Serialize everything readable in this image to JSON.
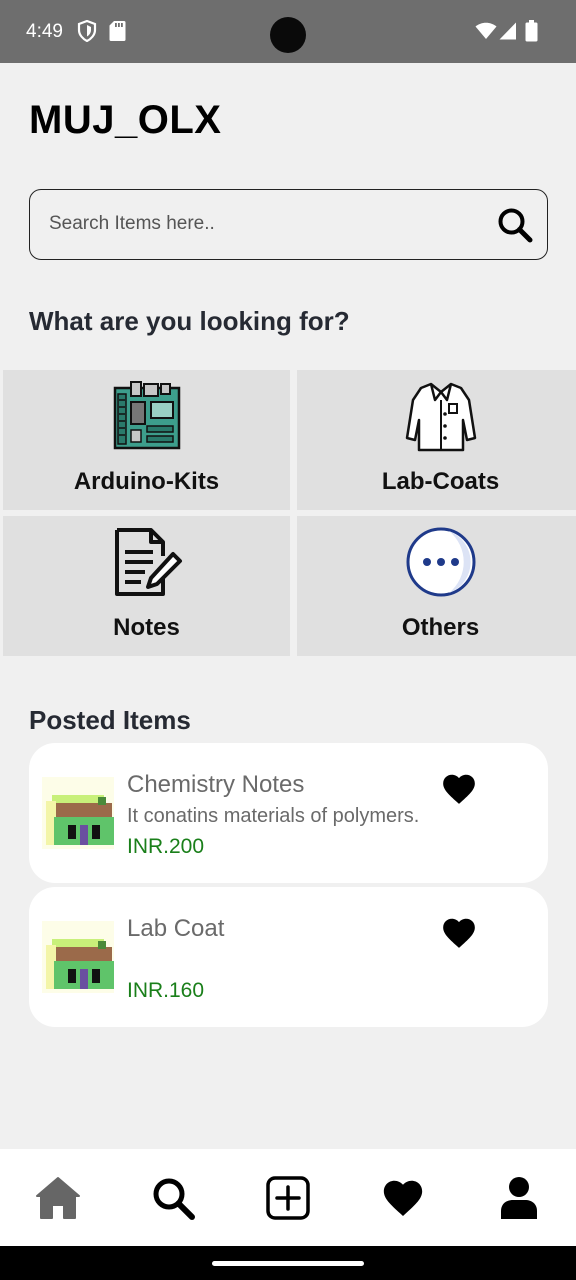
{
  "status_bar": {
    "time": "4:49",
    "icons": [
      "shield-icon",
      "sd-card-icon",
      "wifi-icon",
      "signal-icon",
      "battery-icon"
    ]
  },
  "app": {
    "title": "MUJ_OLX"
  },
  "search": {
    "placeholder": "Search Items here..",
    "value": "",
    "icon": "search-icon"
  },
  "categories_section": {
    "title": "What are you looking for?",
    "items": [
      {
        "label": "Arduino-Kits",
        "icon": "circuit-board-icon"
      },
      {
        "label": "Lab-Coats",
        "icon": "lab-coat-icon"
      },
      {
        "label": "Notes",
        "icon": "notes-icon"
      },
      {
        "label": "Others",
        "icon": "more-dots-icon"
      }
    ]
  },
  "posted_section": {
    "title": "Posted Items",
    "items": [
      {
        "title": "Chemistry Notes",
        "description": "It conatins materials of polymers.",
        "price": "INR.200",
        "favorite_icon": "heart-icon"
      },
      {
        "title": "Lab Coat",
        "description": "",
        "price": "INR.160",
        "favorite_icon": "heart-icon"
      }
    ]
  },
  "bottom_nav": {
    "items": [
      {
        "name": "home",
        "icon": "home-icon",
        "active": false
      },
      {
        "name": "search",
        "icon": "search-icon",
        "active": true
      },
      {
        "name": "add",
        "icon": "add-post-icon",
        "active": false
      },
      {
        "name": "favorites",
        "icon": "heart-icon",
        "active": false
      },
      {
        "name": "profile",
        "icon": "profile-icon",
        "active": false
      }
    ]
  },
  "colors": {
    "status_bar": "#6e6e6e",
    "background": "#f0f0f0",
    "category_tile": "#e0e0e0",
    "price": "#1a7f1a",
    "others_icon_accent": "#1f3a8a"
  }
}
